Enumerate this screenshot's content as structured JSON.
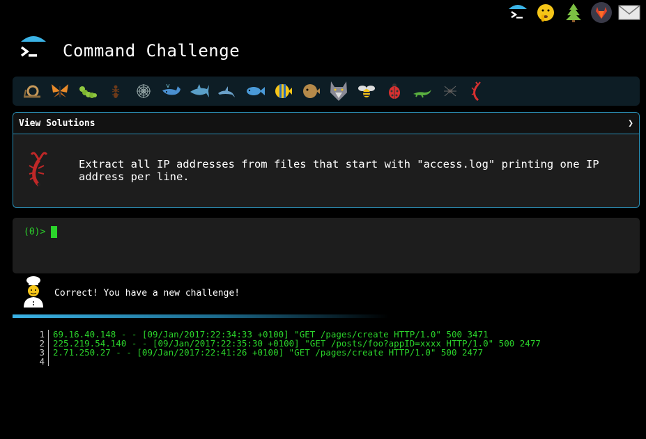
{
  "header": {
    "title": "Command Challenge",
    "logo_icon": "terminal-prompt-umbrella-icon"
  },
  "top_icons": [
    {
      "name": "terminal-umbrella-icon"
    },
    {
      "name": "shushing-face-icon"
    },
    {
      "name": "tree-icon"
    },
    {
      "name": "gitlab-icon"
    },
    {
      "name": "mail-icon"
    }
  ],
  "animals": [
    "snail-icon",
    "butterfly-icon",
    "caterpillar-icon",
    "ant-icon",
    "spider-web-icon",
    "whale-icon",
    "shark-icon",
    "dolphin-icon",
    "fish-icon",
    "tropical-fish-icon",
    "blowfish-icon",
    "wolf-icon",
    "bee-icon",
    "ladybug-icon",
    "lizard-icon",
    "spider-icon",
    "scorpion-icon"
  ],
  "challenge": {
    "view_solutions_label": "View Solutions",
    "chevron": "❯",
    "icon": "scorpion-icon",
    "text": "Extract all IP addresses from files that start with \"access.log\" printing one IP address per line."
  },
  "terminal": {
    "prompt": "(0)>"
  },
  "message": {
    "text": "Correct! You have a new challenge!",
    "icon": "chef-icon"
  },
  "output": {
    "lines": [
      {
        "n": "1",
        "text": "69.16.40.148 - - [09/Jan/2017:22:34:33 +0100] \"GET /pages/create HTTP/1.0\" 500 3471"
      },
      {
        "n": "2",
        "text": "225.219.54.140 - - [09/Jan/2017:22:35:30 +0100] \"GET /posts/foo?appID=xxxx HTTP/1.0\" 500 2477"
      },
      {
        "n": "3",
        "text": "2.71.250.27 - - [09/Jan/2017:22:41:26 +0100] \"GET /pages/create HTTP/1.0\" 500 2477"
      },
      {
        "n": "4",
        "text": ""
      }
    ]
  },
  "colors": {
    "accent": "#2a8fb6",
    "terminal_green": "#2bd42b",
    "panel_bg": "#1d1d1d",
    "animal_bar_bg": "#0d1d25"
  }
}
